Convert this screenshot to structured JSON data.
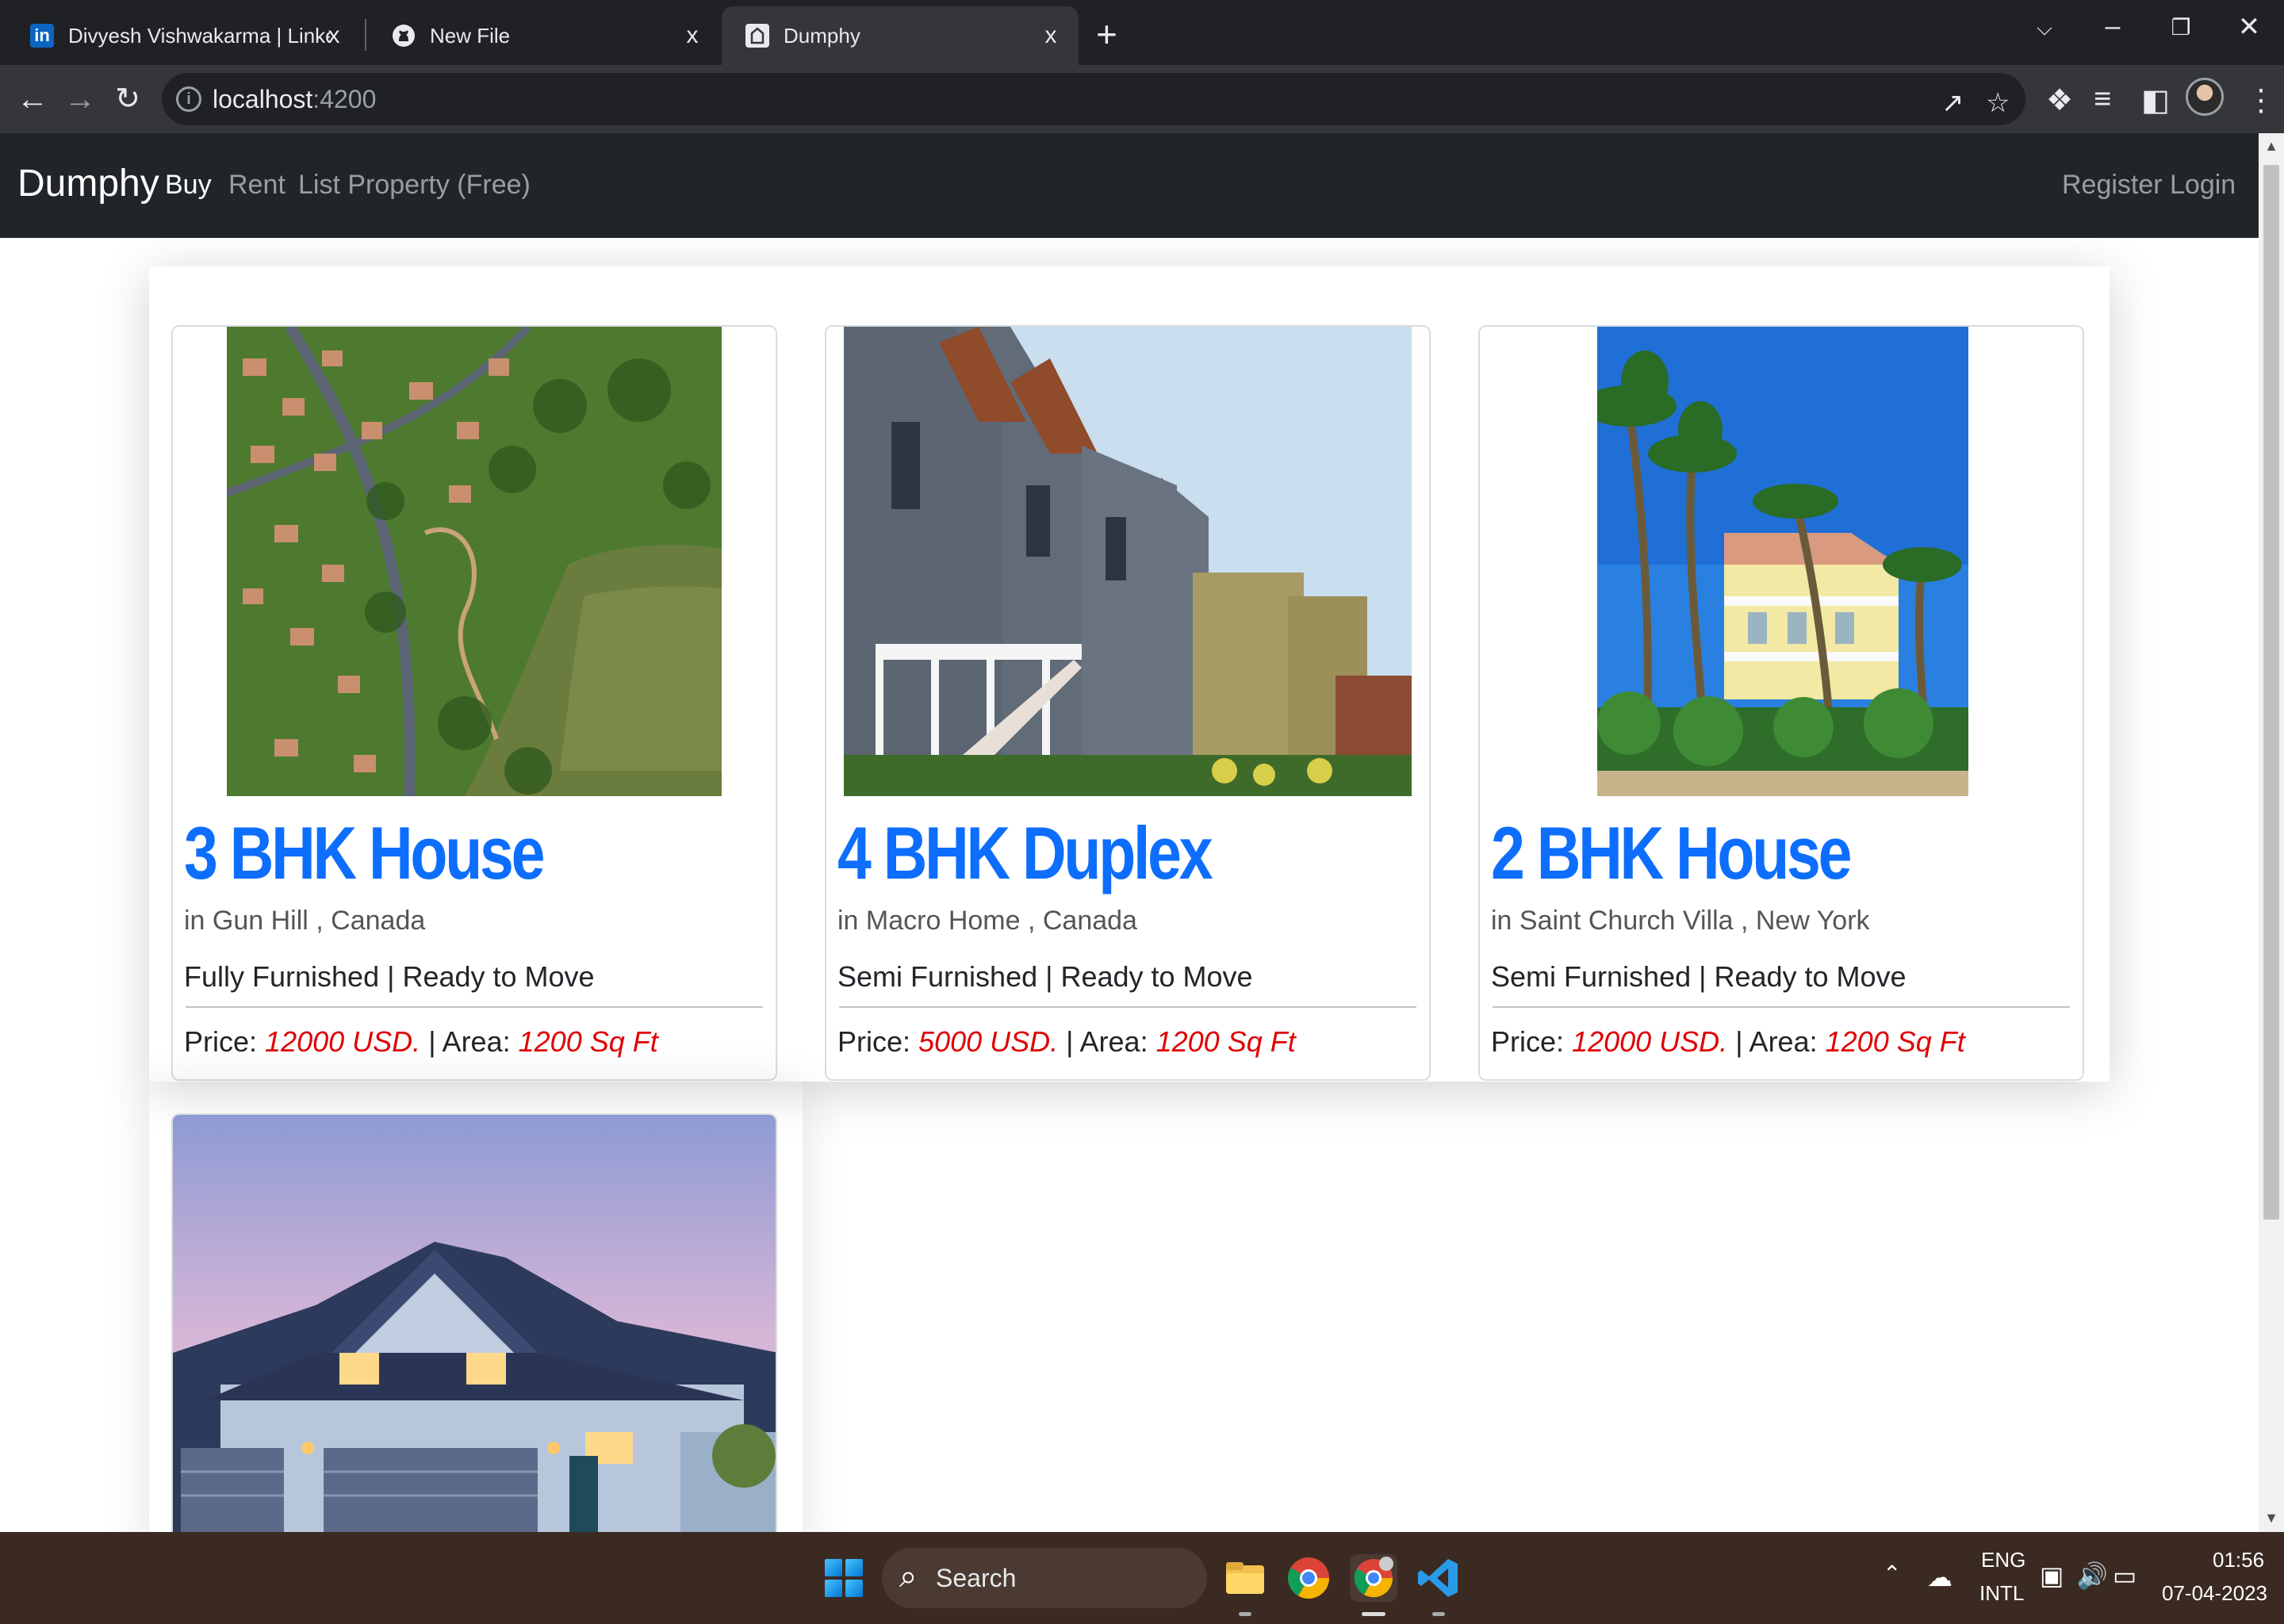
{
  "browser": {
    "tabs": [
      {
        "title": "Divyesh Vishwakarma | LinkedIn",
        "icon": "linkedin-icon",
        "icon_text": "in",
        "icon_color": "#0a66c2"
      },
      {
        "title": "New File",
        "icon": "github-icon"
      },
      {
        "title": "Dumphy",
        "icon": "page-icon"
      }
    ],
    "tab_close_glyph": "x",
    "new_tab_glyph": "+",
    "url_host": "localhost",
    "url_port": ":4200"
  },
  "app": {
    "brand": "Dumphy",
    "nav_left": [
      "Buy",
      "Rent",
      "List Property (Free)"
    ],
    "nav_right": [
      "Register",
      "Login"
    ],
    "accent_color": "#0d6efd",
    "price_color": "#e00000"
  },
  "listings": [
    {
      "title": "3 BHK House",
      "location": "in Gun Hill , Canada",
      "details": "Fully Furnished | Ready to Move",
      "price_label": "Price:",
      "price": "12000 USD.",
      "area_label": "| Area:",
      "area": "1200 Sq Ft",
      "image": "aerial-neighborhood-lake-image"
    },
    {
      "title": "4 BHK Duplex",
      "location": "in Macro Home , Canada",
      "details": "Semi Furnished | Ready to Move",
      "price_label": "Price:",
      "price": "5000 USD.",
      "area_label": "| Area:",
      "area": "1200 Sq Ft",
      "image": "row-townhouses-image"
    },
    {
      "title": "2 BHK House",
      "location": "in Saint Church Villa , New York",
      "details": "Semi Furnished | Ready to Move",
      "price_label": "Price:",
      "price": "12000 USD.",
      "area_label": "| Area:",
      "area": "1200 Sq Ft",
      "image": "palm-trees-villa-image"
    },
    {
      "image": "suburban-house-dusk-image"
    }
  ],
  "taskbar": {
    "search_label": "Search",
    "lang_top": "ENG",
    "lang_bottom": "INTL",
    "time": "01:56",
    "date": "07-04-2023"
  }
}
